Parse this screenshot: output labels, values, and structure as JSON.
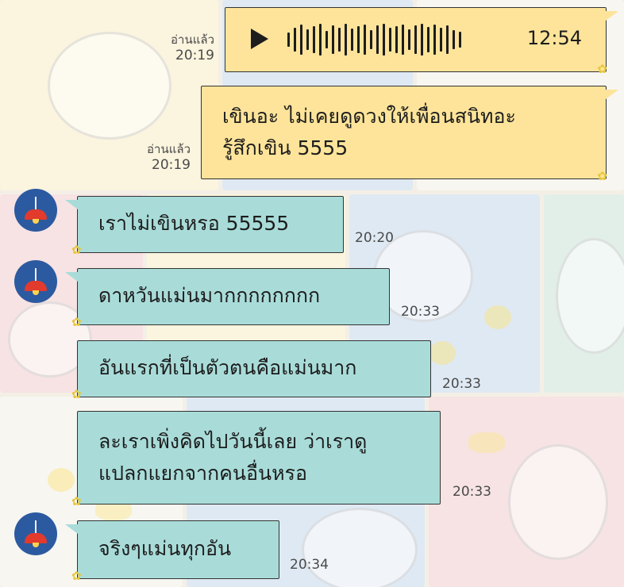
{
  "chat": {
    "voice_message": {
      "duration": "12:54",
      "read_label": "อ่านแล้ว",
      "time": "20:19"
    },
    "outgoing_text": {
      "line1": "เขินอะ ไม่เคยดูดวงให้เพื่อนสนิทอะ",
      "line2": "รู้สึกเขิน 5555",
      "read_label": "อ่านแล้ว",
      "time": "20:19"
    },
    "incoming": [
      {
        "text": "เราไม่เขินหรอ 55555",
        "time": "20:20"
      },
      {
        "text": "ดาหวันแม่นมากกกกกกกก",
        "time": "20:33"
      },
      {
        "text": "อันแรกที่เป็นตัวตนคือแม่นมาก",
        "time": "20:33"
      },
      {
        "line1": "ละเราเพิ่งคิดไปวันนี้เลย ว่าเราดู",
        "line2": "แปลกแยกจากคนอื่นหรอ",
        "time": "20:33"
      },
      {
        "text": "จริงๆแม่นทุกอัน",
        "time": "20:34"
      }
    ]
  },
  "colors": {
    "outgoing_bubble": "#fde49a",
    "incoming_bubble": "#a9dcd9",
    "avatar_bg": "#2c5aa0",
    "lamp": "#e23a2c"
  },
  "icons": {
    "play": "play-icon",
    "waveform": "audio-waveform",
    "avatar": "lamp-avatar",
    "bubble_deco": "chick-sticker-icon"
  }
}
